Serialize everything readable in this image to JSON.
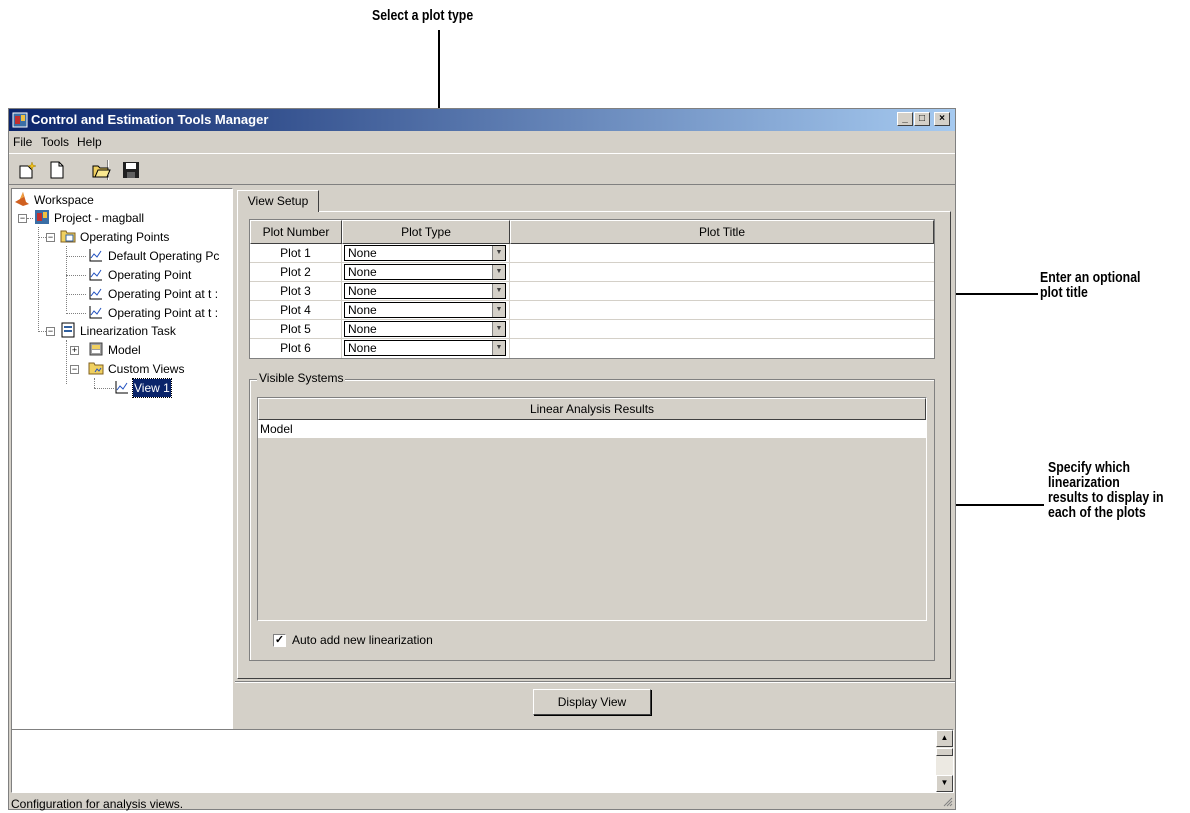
{
  "annotations": {
    "plot_type": "Select a plot type",
    "plot_title_line1": "Enter an optional",
    "plot_title_line2": "plot title",
    "results_line1": "Specify which",
    "results_line2": "linearization",
    "results_line3": "results to display in",
    "results_line4": "each of the plots"
  },
  "window": {
    "title": "Control and Estimation Tools Manager",
    "buttons": {
      "minimize": "_",
      "maximize": "□",
      "close": "×"
    }
  },
  "menu": [
    "File",
    "Tools",
    "Help"
  ],
  "toolbar_icons": [
    "new-project-icon",
    "new-task-icon",
    "open-icon",
    "save-icon"
  ],
  "tree": {
    "workspace": "Workspace",
    "project": "Project - magball",
    "operating_points": "Operating Points",
    "op_items": [
      "Default Operating Pc",
      "Operating Point",
      "Operating Point at t :",
      "Operating Point at t :"
    ],
    "linearization_task": "Linearization Task",
    "model": "Model",
    "custom_views": "Custom Views",
    "view1": "View 1"
  },
  "tab": "View Setup",
  "plot_table": {
    "headers": [
      "Plot Number",
      "Plot Type",
      "Plot Title"
    ],
    "rows": [
      {
        "number": "Plot 1",
        "type": "None",
        "title": ""
      },
      {
        "number": "Plot 2",
        "type": "None",
        "title": ""
      },
      {
        "number": "Plot 3",
        "type": "None",
        "title": ""
      },
      {
        "number": "Plot 4",
        "type": "None",
        "title": ""
      },
      {
        "number": "Plot 5",
        "type": "None",
        "title": ""
      },
      {
        "number": "Plot 6",
        "type": "None",
        "title": ""
      }
    ]
  },
  "visible_systems": {
    "label": "Visible Systems",
    "header": "Linear Analysis Results",
    "rows": [
      "Model"
    ]
  },
  "auto_add": {
    "label": "Auto add new linearization",
    "checked": true,
    "mark": "✓"
  },
  "display_view_button": "Display View",
  "status": "Configuration for analysis views.",
  "colors": {
    "titlebar_start": "#0a246a",
    "titlebar_end": "#a6caf0",
    "face": "#d4d0c8",
    "selection": "#0a246a"
  }
}
